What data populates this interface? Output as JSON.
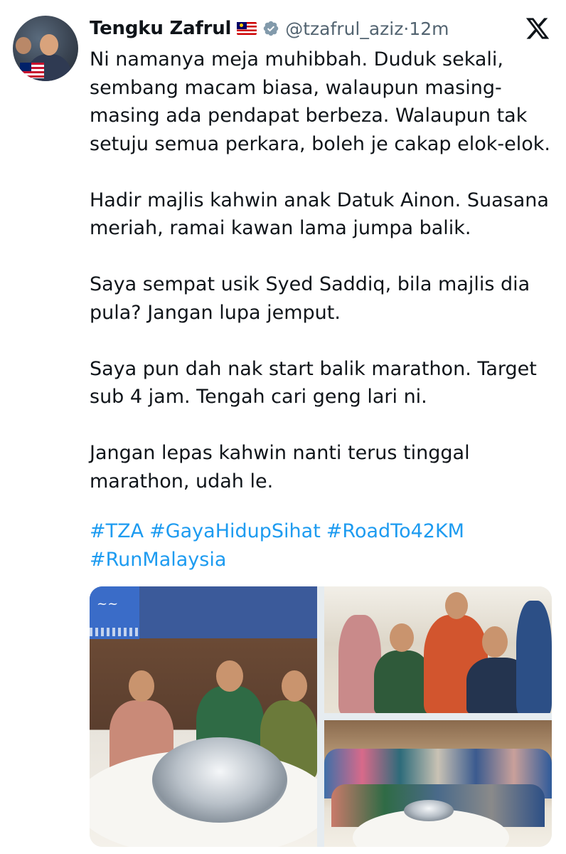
{
  "author": {
    "name": "Tengku Zafrul",
    "handle": "@tzafrul_aziz",
    "separator": "·",
    "time": "12m",
    "flag_icon": "malaysia-flag-icon",
    "verified_icon": "verified-badge-icon"
  },
  "platform_logo": "x-logo-icon",
  "tweet": {
    "paragraphs": [
      "Ni namanya meja muhibbah. Duduk sekali,\nsembang macam biasa, walaupun masing-\nmasing ada pendapat berbeza. Walaupun tak\nsetuju semua perkara, boleh je cakap elok-elok.",
      "Hadir majlis kahwin anak Datuk Ainon. Suasana\nmeriah, ramai kawan lama jumpa balik.",
      "Saya sempat usik Syed Saddiq, bila majlis dia\npula? Jangan lupa jemput.",
      "Saya pun dah nak start balik marathon. Target\nsub 4 jam. Tengah cari geng lari ni.",
      "Jangan lepas kahwin nanti terus tinggal\nmarathon, udah le."
    ],
    "hashtags": [
      "#TZA",
      "#GayaHidupSihat",
      "#RoadTo42KM",
      "#RunMalaysia"
    ]
  },
  "media": {
    "photos": [
      "wedding-table-photo",
      "greeting-guests-photo",
      "group-photo"
    ]
  },
  "colors": {
    "text": "#0f1419",
    "secondary": "#536471",
    "link": "#1d9bf0"
  }
}
